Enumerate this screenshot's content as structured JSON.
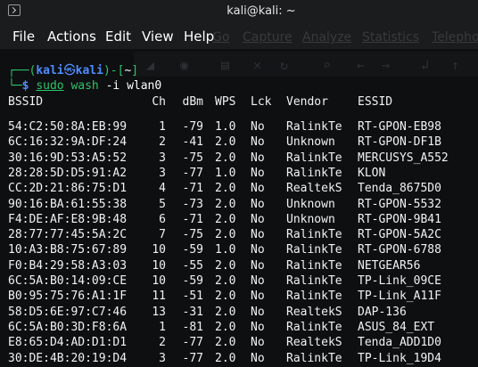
{
  "window": {
    "title": "kali@kali: ~",
    "icon": "terminal-icon"
  },
  "menubar": {
    "items": [
      "File",
      "Actions",
      "Edit",
      "View",
      "Help"
    ],
    "background_menu": [
      "Go",
      "Capture",
      "Analyze",
      "Statistics",
      "Telephony"
    ]
  },
  "prompt": {
    "open": "┌──(",
    "user": "kali",
    "skull": "㉿",
    "host": "kali",
    "mid": ")-[",
    "path": "~",
    "close": "]",
    "line2_prefix": "└─",
    "dollar": "$",
    "cmd_sudo": "sudo",
    "cmd_wash": "wash",
    "cmd_args": "-i wlan0"
  },
  "table": {
    "headers": [
      "BSSID",
      "Ch",
      "dBm",
      "WPS",
      "Lck",
      "Vendor",
      "ESSID"
    ],
    "rows": [
      [
        "54:C2:50:8A:EB:99",
        "1",
        "-79",
        "1.0",
        "No",
        "RalinkTe",
        "RT-GPON-EB98"
      ],
      [
        "6C:16:32:9A:DF:24",
        "2",
        "-41",
        "2.0",
        "No",
        "Unknown",
        "RT-GPON-DF1B"
      ],
      [
        "30:16:9D:53:A5:52",
        "3",
        "-75",
        "2.0",
        "No",
        "RalinkTe",
        "MERCUSYS_A552"
      ],
      [
        "28:28:5D:D5:91:A2",
        "3",
        "-77",
        "1.0",
        "No",
        "RalinkTe",
        "KLON"
      ],
      [
        "CC:2D:21:86:75:D1",
        "4",
        "-71",
        "2.0",
        "No",
        "RealtekS",
        "Tenda_8675D0"
      ],
      [
        "90:16:BA:61:55:38",
        "5",
        "-73",
        "2.0",
        "No",
        "Unknown",
        "RT-GPON-5532"
      ],
      [
        "F4:DE:AF:E8:9B:48",
        "6",
        "-71",
        "2.0",
        "No",
        "Unknown",
        "RT-GPON-9B41"
      ],
      [
        "28:77:77:45:5A:2C",
        "7",
        "-75",
        "2.0",
        "No",
        "RalinkTe",
        "RT-GPON-5A2C"
      ],
      [
        "10:A3:B8:75:67:89",
        "10",
        "-59",
        "1.0",
        "No",
        "RalinkTe",
        "RT-GPON-6788"
      ],
      [
        "F0:B4:29:58:A3:03",
        "10",
        "-55",
        "2.0",
        "No",
        "RalinkTe",
        "NETGEAR56"
      ],
      [
        "6C:5A:B0:14:09:CE",
        "10",
        "-59",
        "2.0",
        "No",
        "RalinkTe",
        "TP-Link_09CE"
      ],
      [
        "B0:95:75:76:A1:1F",
        "11",
        "-51",
        "2.0",
        "No",
        "RalinkTe",
        "TP-Link_A11F"
      ],
      [
        "58:D5:6E:97:C7:46",
        "13",
        "-31",
        "2.0",
        "No",
        "RealtekS",
        "DAP-136"
      ],
      [
        "6C:5A:B0:3D:F8:6A",
        "1",
        "-81",
        "2.0",
        "No",
        "RalinkTe",
        "ASUS_84_EXT"
      ],
      [
        "E8:65:D4:AD:D1:D1",
        "2",
        "-77",
        "2.0",
        "No",
        "RealtekS",
        "Tenda_ADD1D0"
      ],
      [
        "30:DE:4B:20:19:D4",
        "3",
        "-77",
        "2.0",
        "No",
        "RalinkTe",
        "TP-Link_19D4"
      ]
    ]
  },
  "colors": {
    "prompt_green": "#2bc56a",
    "prompt_blue": "#4f8cff",
    "text": "#f2f2f2",
    "background": "#0e0f11"
  }
}
